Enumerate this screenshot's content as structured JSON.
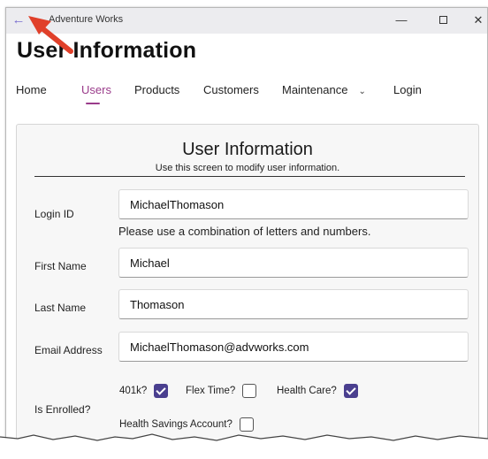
{
  "window": {
    "title": "Adventure Works",
    "back_icon": "back-arrow-icon",
    "minimize": "—",
    "close": "✕"
  },
  "page": {
    "title": "User Information"
  },
  "nav": {
    "items": [
      {
        "label": "Home"
      },
      {
        "label": "Users",
        "active": true
      },
      {
        "label": "Products"
      },
      {
        "label": "Customers"
      },
      {
        "label": "Maintenance"
      },
      {
        "label": "Login"
      }
    ],
    "dropdown_glyph": "⌄"
  },
  "form": {
    "title": "User Information",
    "subtitle": "Use this screen to modify user information.",
    "login_id": {
      "label": "Login ID",
      "value": "MichaelThomason",
      "hint": "Please use a combination of letters and numbers."
    },
    "first_name": {
      "label": "First Name",
      "value": "Michael"
    },
    "last_name": {
      "label": "Last Name",
      "value": "Thomason"
    },
    "email": {
      "label": "Email Address",
      "value": "MichaelThomason@advworks.com"
    },
    "enrolled": {
      "label": "Is Enrolled?",
      "options": [
        {
          "label": "401k?",
          "checked": true
        },
        {
          "label": "Flex Time?",
          "checked": false
        },
        {
          "label": "Health Care?",
          "checked": true
        },
        {
          "label": "Health Savings Account?",
          "checked": false
        }
      ]
    }
  },
  "colors": {
    "accent": "#9a3b8a",
    "checkbox_checked": "#4a3f8f",
    "callout_arrow": "#e0402a"
  }
}
